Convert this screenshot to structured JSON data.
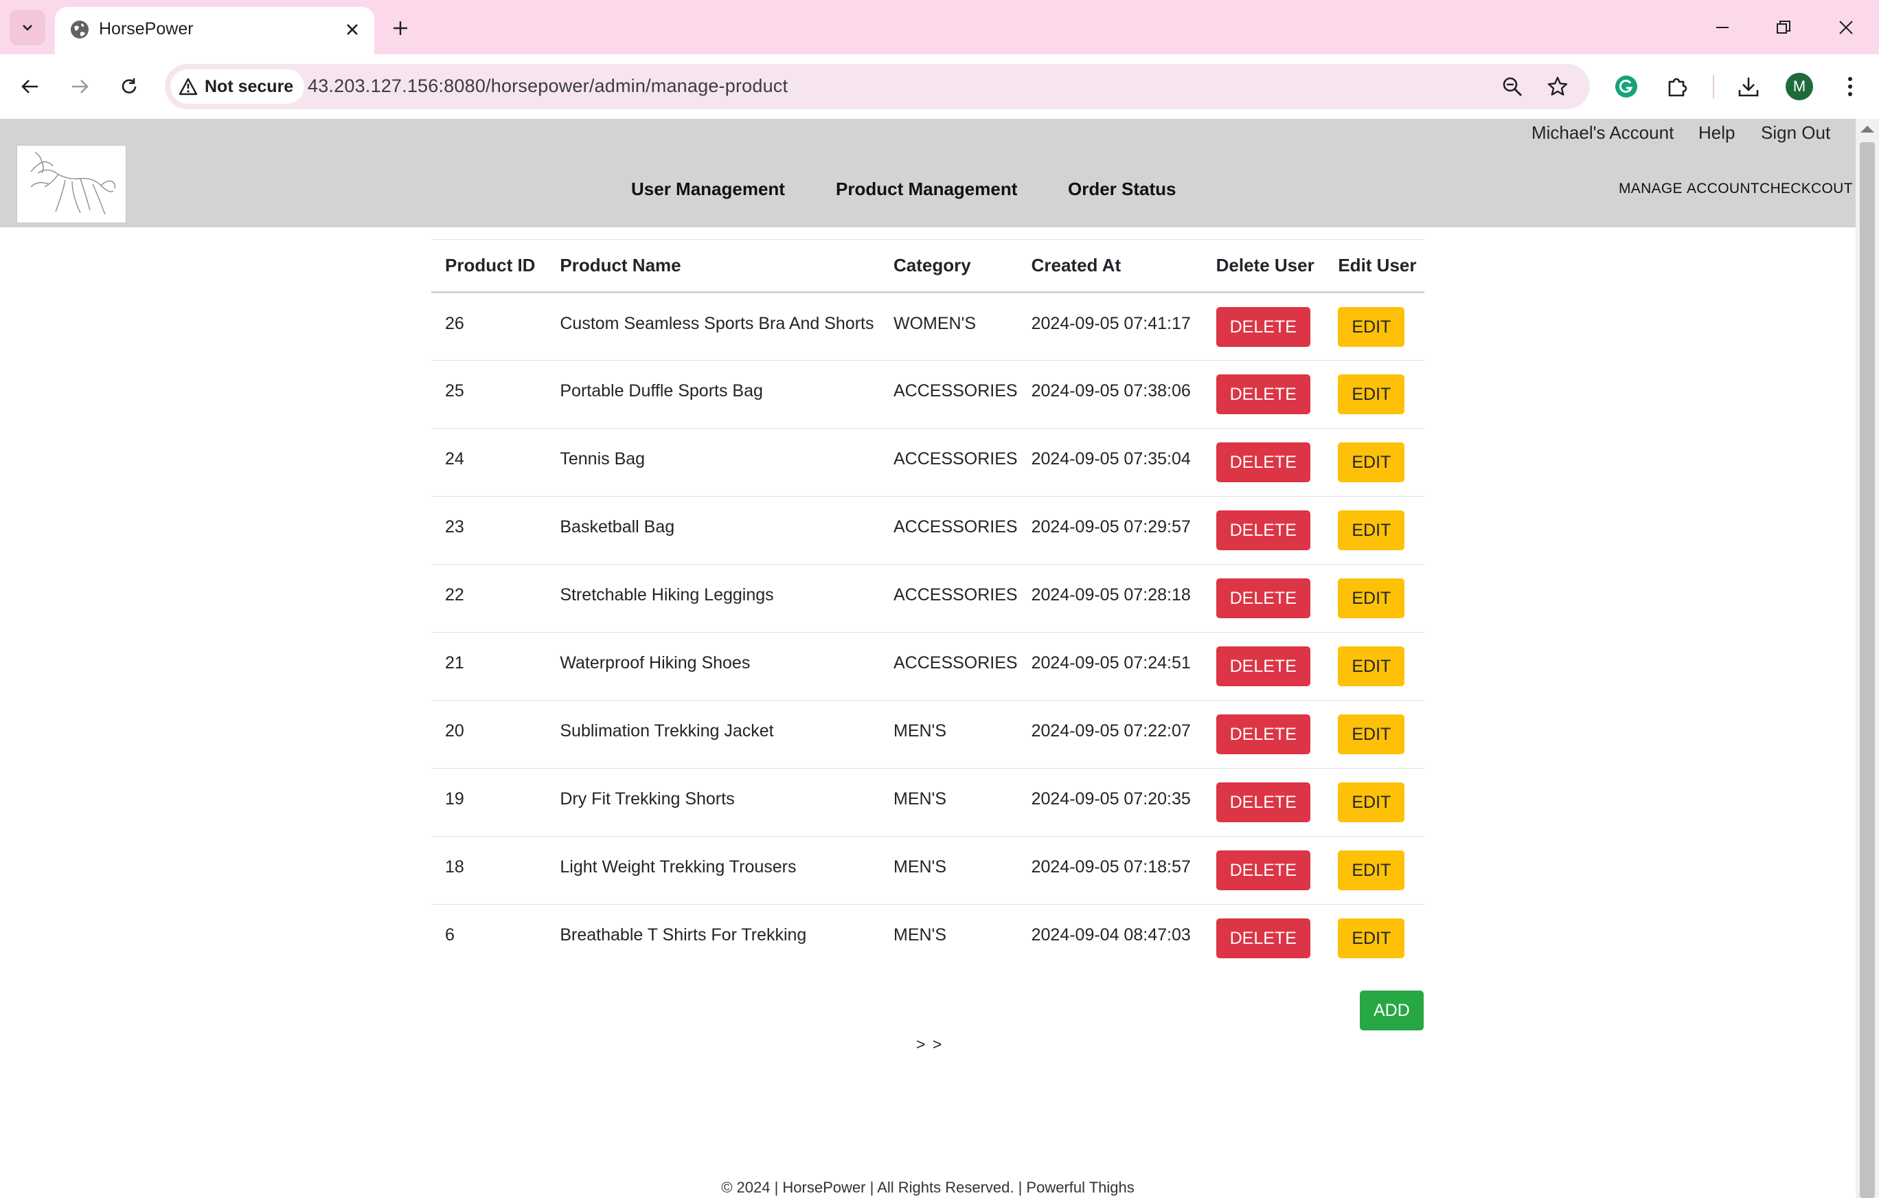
{
  "browser": {
    "tab_title": "HorsePower",
    "security_label": "Not secure",
    "url": "43.203.127.156:8080/horsepower/admin/manage-product",
    "profile_initial": "M"
  },
  "header": {
    "util_links": [
      "Michael's Account",
      "Help",
      "Sign Out"
    ],
    "main_nav": [
      "User Management",
      "Product Management",
      "Order Status"
    ],
    "small_links": [
      "MANAGE",
      "ACCOUNT",
      "CHECKCOUT"
    ]
  },
  "table": {
    "columns": [
      "Product ID",
      "Product Name",
      "Category",
      "Created At",
      "Delete User",
      "Edit User"
    ],
    "delete_label": "DELETE",
    "edit_label": "EDIT",
    "rows": [
      {
        "id": "26",
        "name": "Custom Seamless Sports Bra And Shorts",
        "category": "WOMEN'S",
        "created": "2024-09-05 07:41:17"
      },
      {
        "id": "25",
        "name": "Portable Duffle Sports Bag",
        "category": "ACCESSORIES",
        "created": "2024-09-05 07:38:06"
      },
      {
        "id": "24",
        "name": "Tennis Bag",
        "category": "ACCESSORIES",
        "created": "2024-09-05 07:35:04"
      },
      {
        "id": "23",
        "name": "Basketball Bag",
        "category": "ACCESSORIES",
        "created": "2024-09-05 07:29:57"
      },
      {
        "id": "22",
        "name": "Stretchable Hiking Leggings",
        "category": "ACCESSORIES",
        "created": "2024-09-05 07:28:18"
      },
      {
        "id": "21",
        "name": "Waterproof Hiking Shoes",
        "category": "ACCESSORIES",
        "created": "2024-09-05 07:24:51"
      },
      {
        "id": "20",
        "name": "Sublimation Trekking Jacket",
        "category": "MEN'S",
        "created": "2024-09-05 07:22:07"
      },
      {
        "id": "19",
        "name": "Dry Fit Trekking Shorts",
        "category": "MEN'S",
        "created": "2024-09-05 07:20:35"
      },
      {
        "id": "18",
        "name": "Light Weight Trekking Trousers",
        "category": "MEN'S",
        "created": "2024-09-05 07:18:57"
      },
      {
        "id": "6",
        "name": "Breathable T Shirts For Trekking",
        "category": "MEN'S",
        "created": "2024-09-04 08:47:03"
      }
    ]
  },
  "add_label": "ADD",
  "pager_label": "> >",
  "footer": "© 2024 | HorsePower | All Rights Reserved. | Powerful Thighs",
  "colors": {
    "tabbar": "#fbd9ea",
    "header_bg": "#d3d3d3",
    "delete": "#dc3545",
    "edit": "#ffc107",
    "add": "#28a745"
  }
}
